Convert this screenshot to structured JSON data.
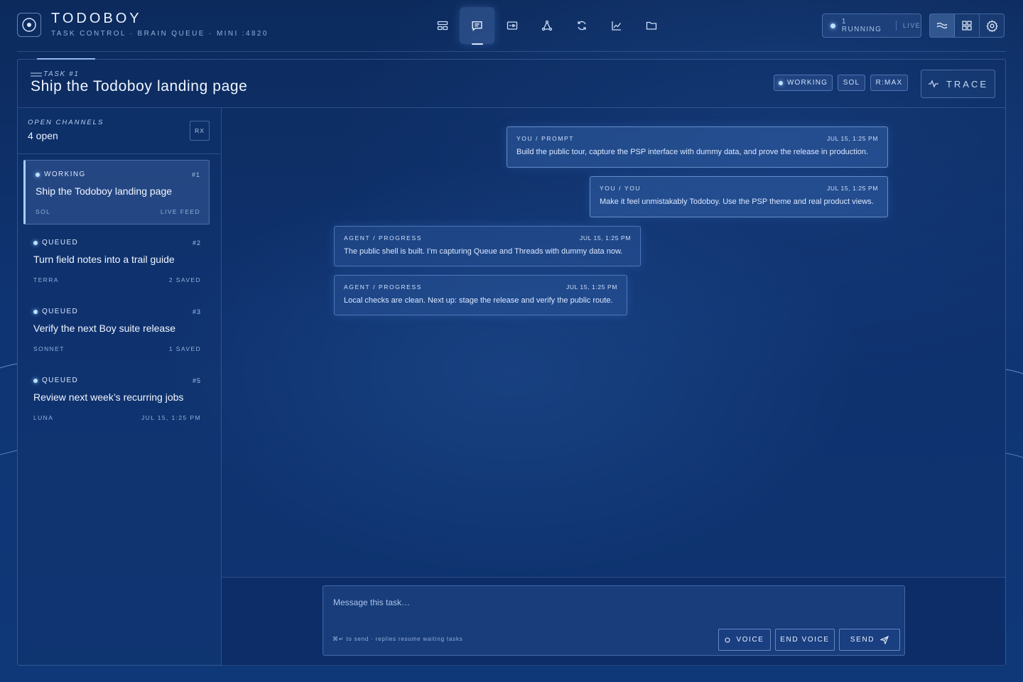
{
  "app": {
    "title": "TODOBOY",
    "subtitle": "TASK CONTROL · BRAIN QUEUE · MINI :4820"
  },
  "nav": {
    "items": [
      {
        "icon": "queue-layout-icon",
        "active": false
      },
      {
        "icon": "chat-threads-icon",
        "active": true
      },
      {
        "icon": "inbox-icon",
        "active": false
      },
      {
        "icon": "graph-nodes-icon",
        "active": false
      },
      {
        "icon": "refresh-icon",
        "active": false
      },
      {
        "icon": "trend-chart-icon",
        "active": false
      },
      {
        "icon": "folder-icon",
        "active": false
      }
    ]
  },
  "status": {
    "running": "1 RUNNING",
    "live": "LIVE"
  },
  "toolbar_icons": [
    "waves-icon",
    "grid-icon",
    "settings-gear-icon"
  ],
  "task": {
    "label": "TASK #1",
    "title": "Ship the Todoboy landing page",
    "chips": {
      "status": "WORKING",
      "model": "SOL",
      "reasoning": "R:MAX"
    },
    "trace_label": "TRACE"
  },
  "channels": {
    "label": "OPEN CHANNELS",
    "count": "4 open",
    "rx_label": "RX",
    "items": [
      {
        "status": "WORKING",
        "num": "#1",
        "title": "Ship the Todoboy landing page",
        "model": "SOL",
        "meta": "LIVE FEED"
      },
      {
        "status": "QUEUED",
        "num": "#2",
        "title": "Turn field notes into a trail guide",
        "model": "TERRA",
        "meta": "2 SAVED"
      },
      {
        "status": "QUEUED",
        "num": "#3",
        "title": "Verify the next Boy suite release",
        "model": "SONNET",
        "meta": "1 SAVED"
      },
      {
        "status": "QUEUED",
        "num": "#5",
        "title": "Review next week’s recurring jobs",
        "model": "LUNA",
        "meta": "JUL 15, 1:25 PM"
      }
    ]
  },
  "messages": [
    {
      "from": "YOU / PROMPT",
      "time": "JUL 15, 1:25 PM",
      "body": "Build the public tour, capture the PSP interface with dummy data, and prove the release in production."
    },
    {
      "from": "YOU / YOU",
      "time": "JUL 15, 1:25 PM",
      "body": "Make it feel unmistakably Todoboy. Use the PSP theme and real product views."
    },
    {
      "from": "AGENT / PROGRESS",
      "time": "JUL 15, 1:25 PM",
      "body": "The public shell is built. I’m capturing Queue and Threads with dummy data now."
    },
    {
      "from": "AGENT / PROGRESS",
      "time": "JUL 15, 1:25 PM",
      "body": "Local checks are clean. Next up: stage the release and verify the public route."
    }
  ],
  "composer": {
    "placeholder": "Message this task…",
    "hint": "⌘↵ to send · replies resume waiting tasks",
    "voice": "VOICE",
    "end_voice": "END VOICE",
    "send": "SEND"
  },
  "colors": {
    "background": "#0f3473",
    "accent": "#a9d0ff",
    "status_dot": "#bfe0ff"
  }
}
